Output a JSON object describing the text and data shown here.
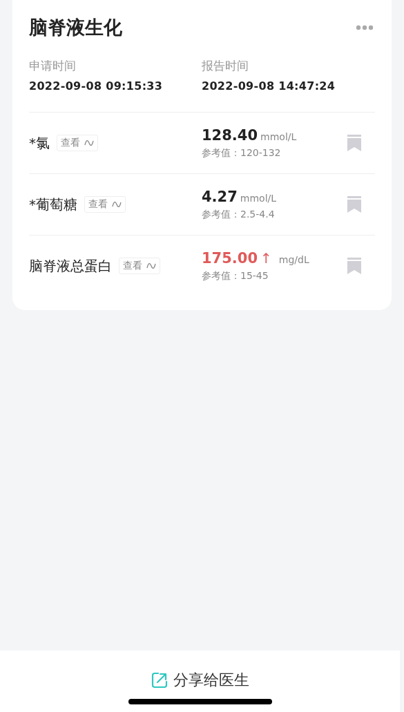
{
  "report": {
    "title": "脑脊液生化",
    "times": [
      {
        "label": "申请时间",
        "value": "2022-09-08 09:15:33"
      },
      {
        "label": "报告时间",
        "value": "2022-09-08 14:47:24"
      }
    ],
    "items": [
      {
        "name": "*氯",
        "view": "查看",
        "value": "128.40",
        "unit": "mmol/L",
        "reference": "参考值：120-132",
        "abnormal": false
      },
      {
        "name": "*葡萄糖",
        "view": "查看",
        "value": "4.27",
        "unit": "mmol/L",
        "reference": "参考值：2.5-4.4",
        "abnormal": false
      },
      {
        "name": "脑脊液总蛋白",
        "view": "查看",
        "value": "175.00",
        "arrow": "↑",
        "unit": "mg/dL",
        "reference": "参考值：15-45",
        "abnormal": true
      }
    ]
  },
  "share_button": {
    "label": "分享给医生"
  }
}
